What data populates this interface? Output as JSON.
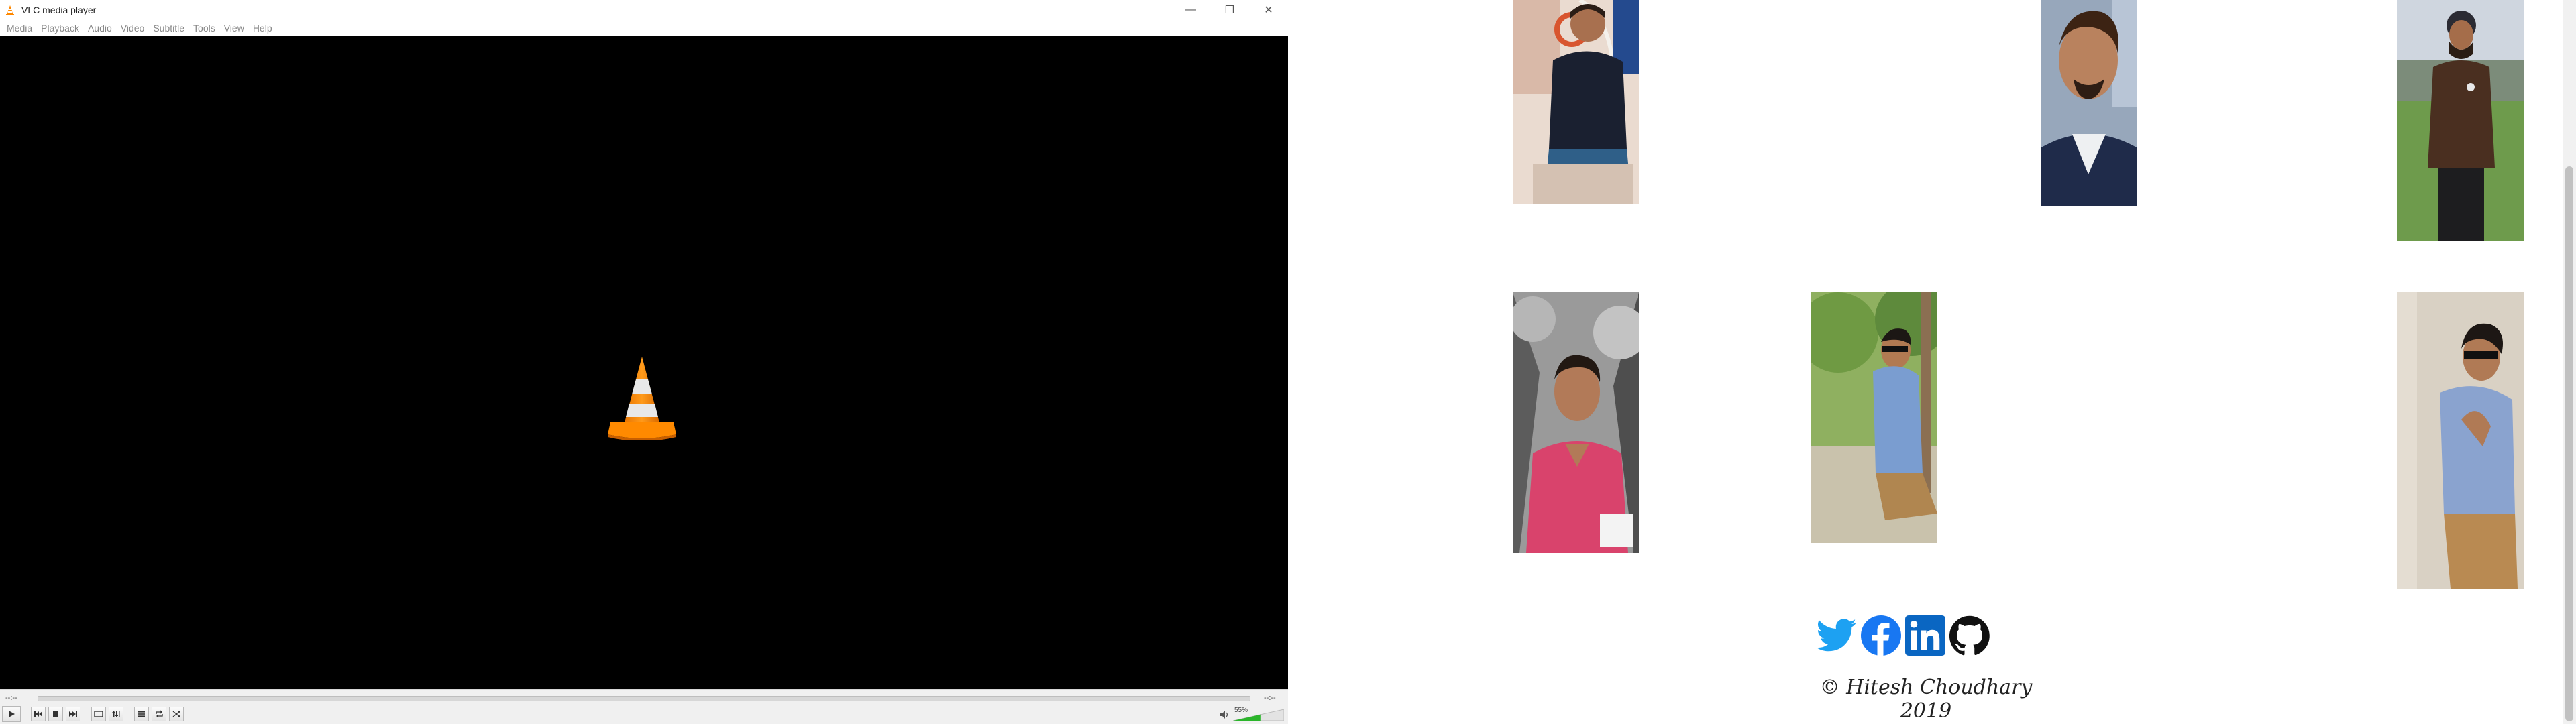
{
  "vlc": {
    "title": "VLC media player",
    "window_controls": {
      "minimize": "—",
      "restore": "❐",
      "close": "✕"
    },
    "menu": [
      "Media",
      "Playback",
      "Audio",
      "Video",
      "Subtitle",
      "Tools",
      "View",
      "Help"
    ],
    "time_elapsed": "--:--",
    "time_total": "--:--",
    "volume_percent": "55%",
    "volume_level": 0.55,
    "seek_position": 0,
    "colors": {
      "accent": "#ff8800",
      "volume": "#2bb52b"
    }
  },
  "webpage": {
    "photos": [
      {
        "description": "man in black t-shirt sitting in white swing chair"
      },
      {
        "description": "smiling man close-up portrait"
      },
      {
        "description": "man in brown shirt and turban on lawn"
      },
      {
        "description": "man in pink shirt against monochrome background"
      },
      {
        "description": "man in blue shirt and sunglasses sitting outdoors"
      },
      {
        "description": "man in blue shirt and sunglasses seated against beige wall"
      }
    ],
    "social_icons": [
      "twitter-icon",
      "facebook-icon",
      "linkedin-icon",
      "github-icon"
    ],
    "copyright": "© Hitesh Choudhary 2019",
    "colors": {
      "twitter": "#1da1f2",
      "facebook": "#1877f2",
      "linkedin": "#0a66c2",
      "github": "#000000"
    }
  }
}
